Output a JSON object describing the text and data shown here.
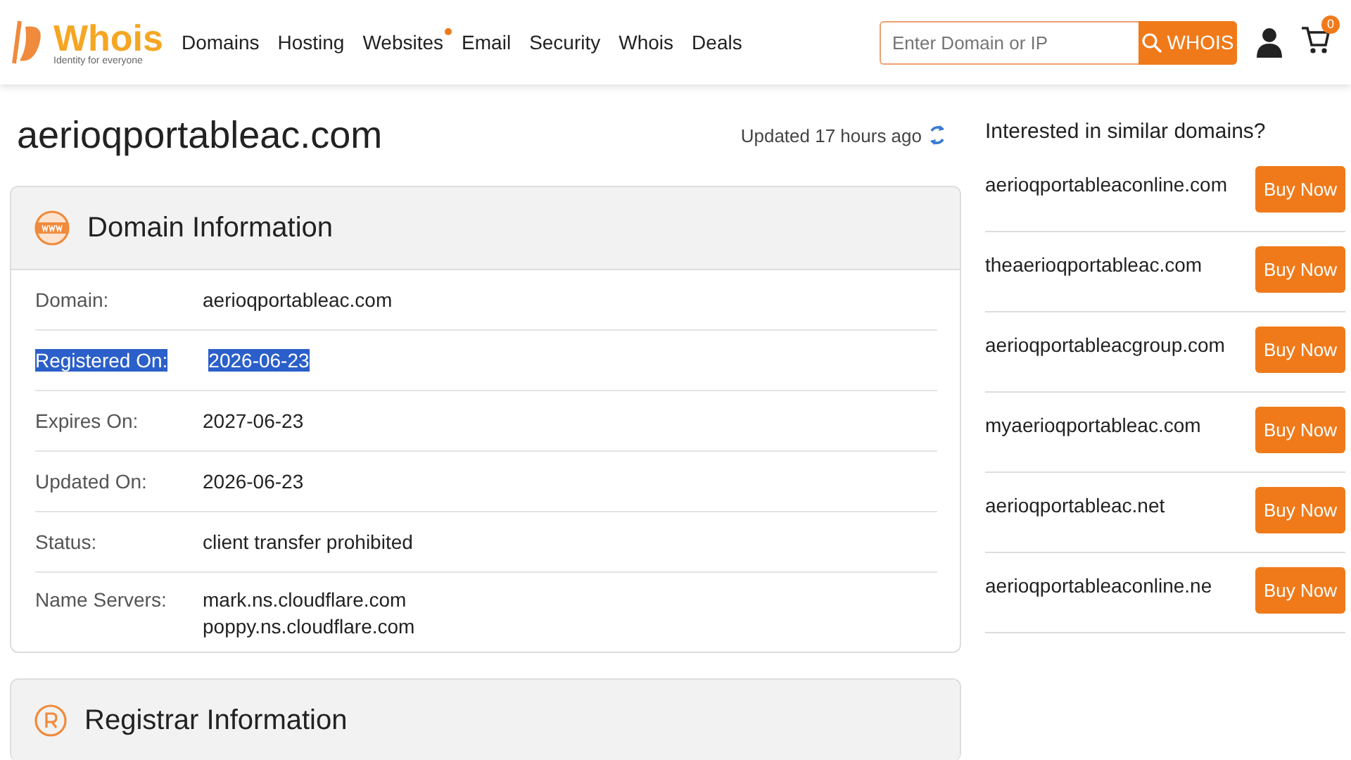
{
  "header": {
    "logo": {
      "name": "Whois",
      "tagline": "Identity for everyone"
    },
    "nav": [
      {
        "label": "Domains",
        "badge": false
      },
      {
        "label": "Hosting",
        "badge": false
      },
      {
        "label": "Websites",
        "badge": true
      },
      {
        "label": "Email",
        "badge": false
      },
      {
        "label": "Security",
        "badge": false
      },
      {
        "label": "Whois",
        "badge": false
      },
      {
        "label": "Deals",
        "badge": false
      }
    ],
    "search": {
      "placeholder": "Enter Domain or IP",
      "button": "WHOIS"
    },
    "cart_count": "0"
  },
  "domain_title": "aerioqportableac.com",
  "updated": "Updated 17 hours ago",
  "domain_info": {
    "title": "Domain Information",
    "rows": [
      {
        "label": "Domain:",
        "values": [
          "aerioqportableac.com"
        ],
        "selected": false
      },
      {
        "label": "Registered On:",
        "values": [
          "2026-06-23"
        ],
        "selected": true
      },
      {
        "label": "Expires On:",
        "values": [
          "2027-06-23"
        ],
        "selected": false
      },
      {
        "label": "Updated On:",
        "values": [
          "2026-06-23"
        ],
        "selected": false
      },
      {
        "label": "Status:",
        "values": [
          "client transfer prohibited"
        ],
        "selected": false
      },
      {
        "label": "Name Servers:",
        "values": [
          "mark.ns.cloudflare.com",
          "poppy.ns.cloudflare.com"
        ],
        "selected": false
      }
    ]
  },
  "registrar_info": {
    "title": "Registrar Information"
  },
  "similar": {
    "title": "Interested in similar domains?",
    "items": [
      {
        "domain": "aerioqportableaconline.com",
        "button": "Buy Now"
      },
      {
        "domain": "theaerioqportableac.com",
        "button": "Buy Now"
      },
      {
        "domain": "aerioqportableacgroup.com",
        "button": "Buy Now"
      },
      {
        "domain": "myaerioqportableac.com",
        "button": "Buy Now"
      },
      {
        "domain": "aerioqportableac.net",
        "button": "Buy Now"
      },
      {
        "domain": "aerioqportableaconline.ne",
        "button": "Buy Now"
      }
    ]
  }
}
